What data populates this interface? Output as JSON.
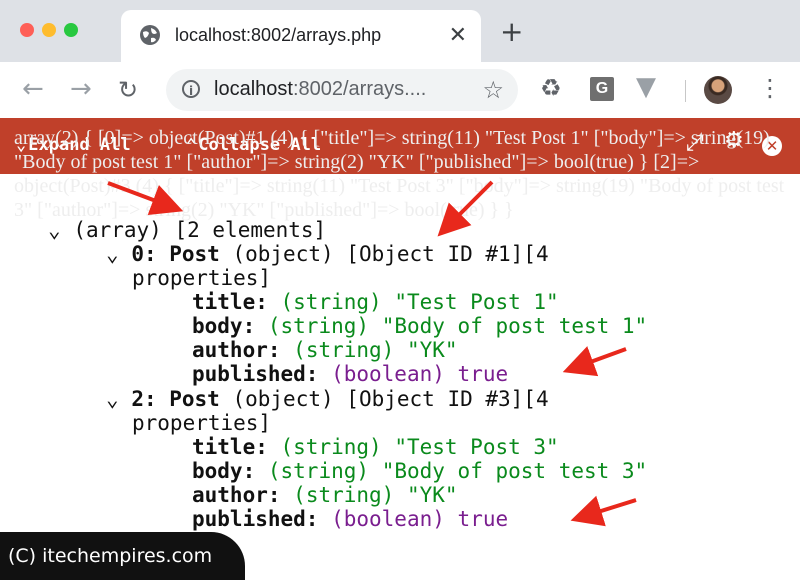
{
  "browser": {
    "tab_title": "localhost:8002/arrays.php",
    "url_host": "localhost",
    "url_rest": ":8002/arrays...."
  },
  "toolbar": {
    "expand_all": "Expand All",
    "collapse_all": "Collapse All"
  },
  "ghost_text": "array(2) { [0]=> object(Post)#1 (4) { [\"title\"]=> string(11) \"Test Post 1\" [\"body\"]=> string(19) \"Body of post test 1\" [\"author\"]=> string(2) \"YK\" [\"published\"]=> bool(true) } [2]=> object(Post)#3 (4) { [\"title\"]=> string(11) \"Test Post 3\" [\"body\"]=> string(19) \"Body of post test 3\" [\"author\"]=> string(2) \"YK\" [\"published\"]=> bool(true) } }",
  "dump": {
    "root": {
      "toggle": "⌄",
      "type": "(array)",
      "count": "[2 elements]"
    },
    "items": [
      {
        "toggle": "⌄",
        "key": "0: Post",
        "type": "(object)",
        "meta": "[Object ID #1][4",
        "meta2": "properties]",
        "props": [
          {
            "name": "title:",
            "type": "(string)",
            "value": "\"Test Post 1\"",
            "kind": "str"
          },
          {
            "name": "body:",
            "type": "(string)",
            "value": "\"Body of post test 1\"",
            "kind": "str"
          },
          {
            "name": "author:",
            "type": "(string)",
            "value": "\"YK\"",
            "kind": "str"
          },
          {
            "name": "published:",
            "type": "(boolean)",
            "value": "true",
            "kind": "bool"
          }
        ]
      },
      {
        "toggle": "⌄",
        "key": "2: Post",
        "type": "(object)",
        "meta": "[Object ID #3][4",
        "meta2": "properties]",
        "props": [
          {
            "name": "title:",
            "type": "(string)",
            "value": "\"Test Post 3\"",
            "kind": "str"
          },
          {
            "name": "body:",
            "type": "(string)",
            "value": "\"Body of post test 3\"",
            "kind": "str"
          },
          {
            "name": "author:",
            "type": "(string)",
            "value": "\"YK\"",
            "kind": "str"
          },
          {
            "name": "published:",
            "type": "(boolean)",
            "value": "true",
            "kind": "bool"
          }
        ]
      }
    ]
  },
  "watermark": "(C) itechempires.com",
  "colors": {
    "header_bar": "#c0402a",
    "string": "#0a8a1c",
    "boolean": "#7a1e8f",
    "arrow": "#e8281c"
  }
}
